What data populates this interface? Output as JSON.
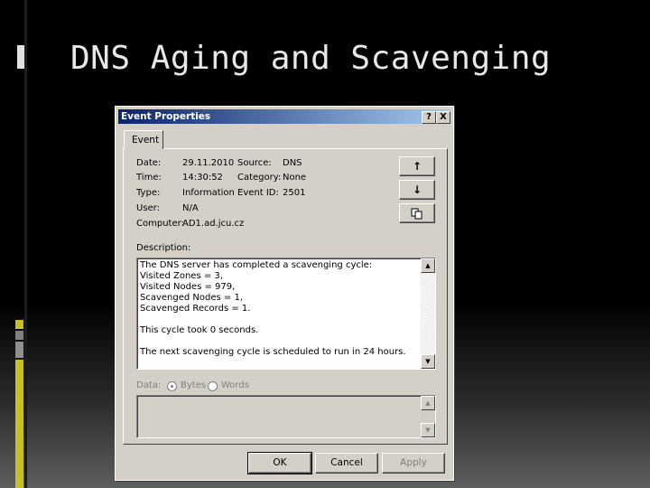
{
  "slide": {
    "title": "DNS Aging and Scavenging"
  },
  "colors": {
    "titlebar_start": "#0a246a",
    "titlebar_end": "#a6caf0",
    "dialog_face": "#d4d0c8",
    "accent_marks": "#c8c020"
  },
  "dialog": {
    "title": "Event Properties",
    "help_label": "?",
    "close_label": "X",
    "tab_label": "Event",
    "labels": {
      "date": "Date:",
      "time": "Time:",
      "type": "Type:",
      "user": "User:",
      "computer": "Computer:",
      "source": "Source:",
      "category": "Category:",
      "event_id": "Event ID:"
    },
    "values": {
      "date": "29.11.2010",
      "time": "14:30:52",
      "type": "Information",
      "user": "N/A",
      "computer": "AD1.ad.jcu.cz",
      "source": "DNS",
      "category": "None",
      "event_id": "2501"
    },
    "side_buttons": {
      "up_icon": "arrow-up-icon",
      "down_icon": "arrow-down-icon",
      "copy_icon": "copy-icon"
    },
    "description_label": "Description:",
    "description_lines": [
      "The DNS server has completed a scavenging cycle:",
      "Visited Zones     = 3,",
      "Visited Nodes     = 979,",
      "Scavenged Nodes   = 1,",
      "Scavenged Records = 1.",
      "",
      "This cycle took 0 seconds.",
      "",
      "The next scavenging cycle is scheduled to run in 24 hours."
    ],
    "data_label": "Data:",
    "bytes_label": "Bytes",
    "words_label": "Words",
    "ok_label": "OK",
    "cancel_label": "Cancel",
    "apply_label": "Apply"
  }
}
